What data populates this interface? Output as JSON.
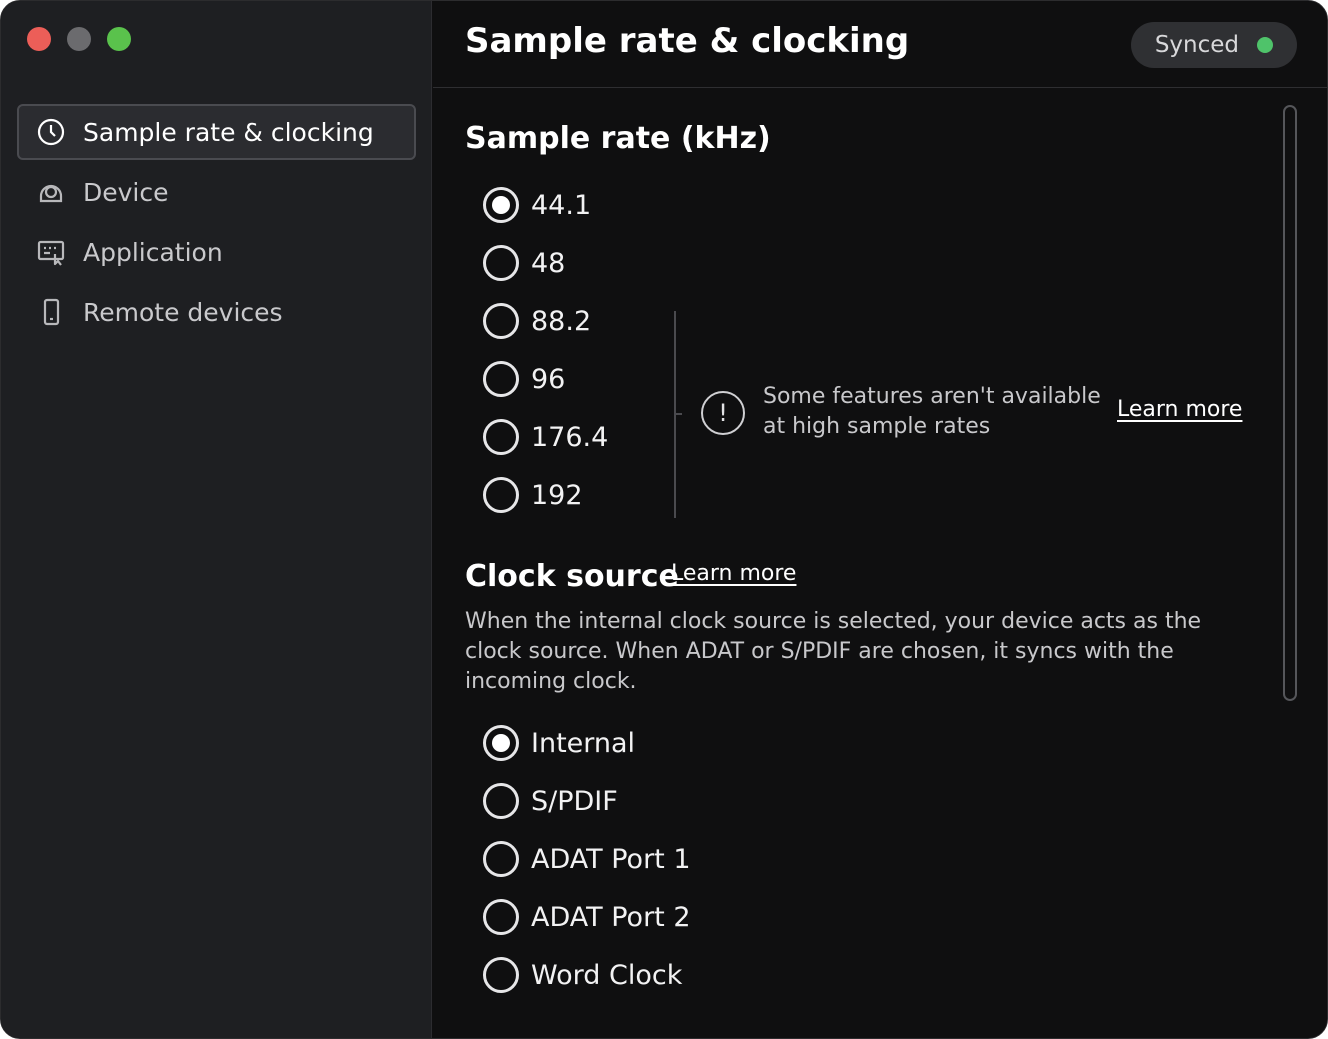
{
  "sidebar": {
    "items": [
      {
        "label": "Sample rate & clocking",
        "icon": "clock-icon",
        "active": true
      },
      {
        "label": "Device",
        "icon": "device-icon",
        "active": false
      },
      {
        "label": "Application",
        "icon": "application-icon",
        "active": false
      },
      {
        "label": "Remote devices",
        "icon": "phone-icon",
        "active": false
      }
    ]
  },
  "header": {
    "title": "Sample rate & clocking",
    "status_label": "Synced",
    "status_color": "#4fc36a"
  },
  "sample_rate": {
    "title": "Sample rate (kHz)",
    "options": [
      "44.1",
      "48",
      "88.2",
      "96",
      "176.4",
      "192"
    ],
    "selected": "44.1",
    "warning_text": "Some features aren't available at high sample rates",
    "learn_more": "Learn more"
  },
  "clock_source": {
    "title": "Clock source",
    "learn_more": "Learn more",
    "description": "When the internal clock source is selected, your device acts as the clock source. When ADAT or S/PDIF are chosen, it syncs with the incoming clock.",
    "options": [
      "Internal",
      "S/PDIF",
      "ADAT Port 1",
      "ADAT Port 2",
      "Word Clock"
    ],
    "selected": "Internal"
  }
}
